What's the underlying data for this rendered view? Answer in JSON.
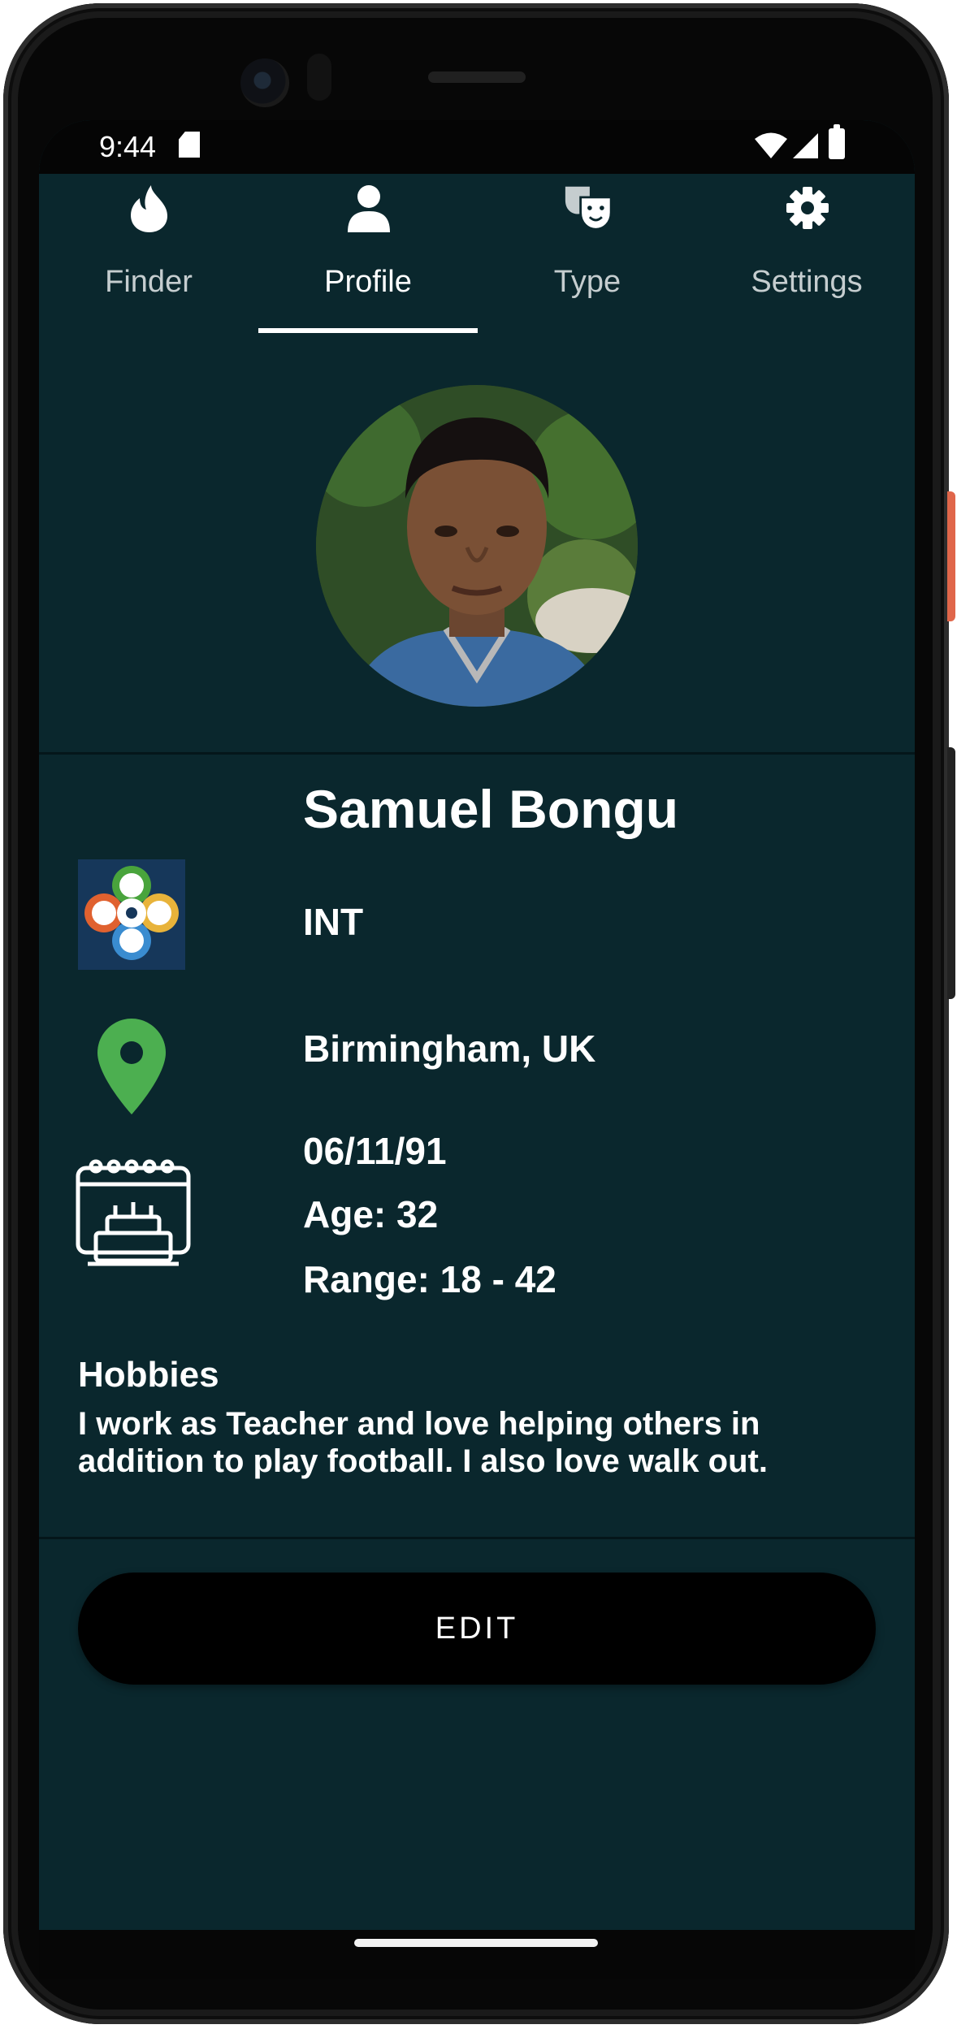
{
  "status_bar": {
    "time": "9:44",
    "icons": [
      "sd-card-icon",
      "wifi-icon",
      "signal-icon",
      "battery-icon"
    ]
  },
  "tabs": [
    {
      "label": "Finder",
      "icon": "flame-icon",
      "active": false
    },
    {
      "label": "Profile",
      "icon": "person-icon",
      "active": true
    },
    {
      "label": "Type",
      "icon": "theater-masks-icon",
      "active": false
    },
    {
      "label": "Settings",
      "icon": "gear-icon",
      "active": false
    }
  ],
  "profile": {
    "name": "Samuel Bongu",
    "type": "INT",
    "location": "Birmingham, UK",
    "birth_date": "06/11/91",
    "age": "Age: 32",
    "range": "Range: 18 - 42",
    "hobbies_title": "Hobbies",
    "hobbies_text": "I work as Teacher and love helping others in addition to play football. I also love walk out."
  },
  "actions": {
    "edit_label": "EDIT"
  },
  "colors": {
    "background": "#0a272d",
    "pin": "#4caf50",
    "button": "#000000",
    "text": "#ffffff"
  }
}
